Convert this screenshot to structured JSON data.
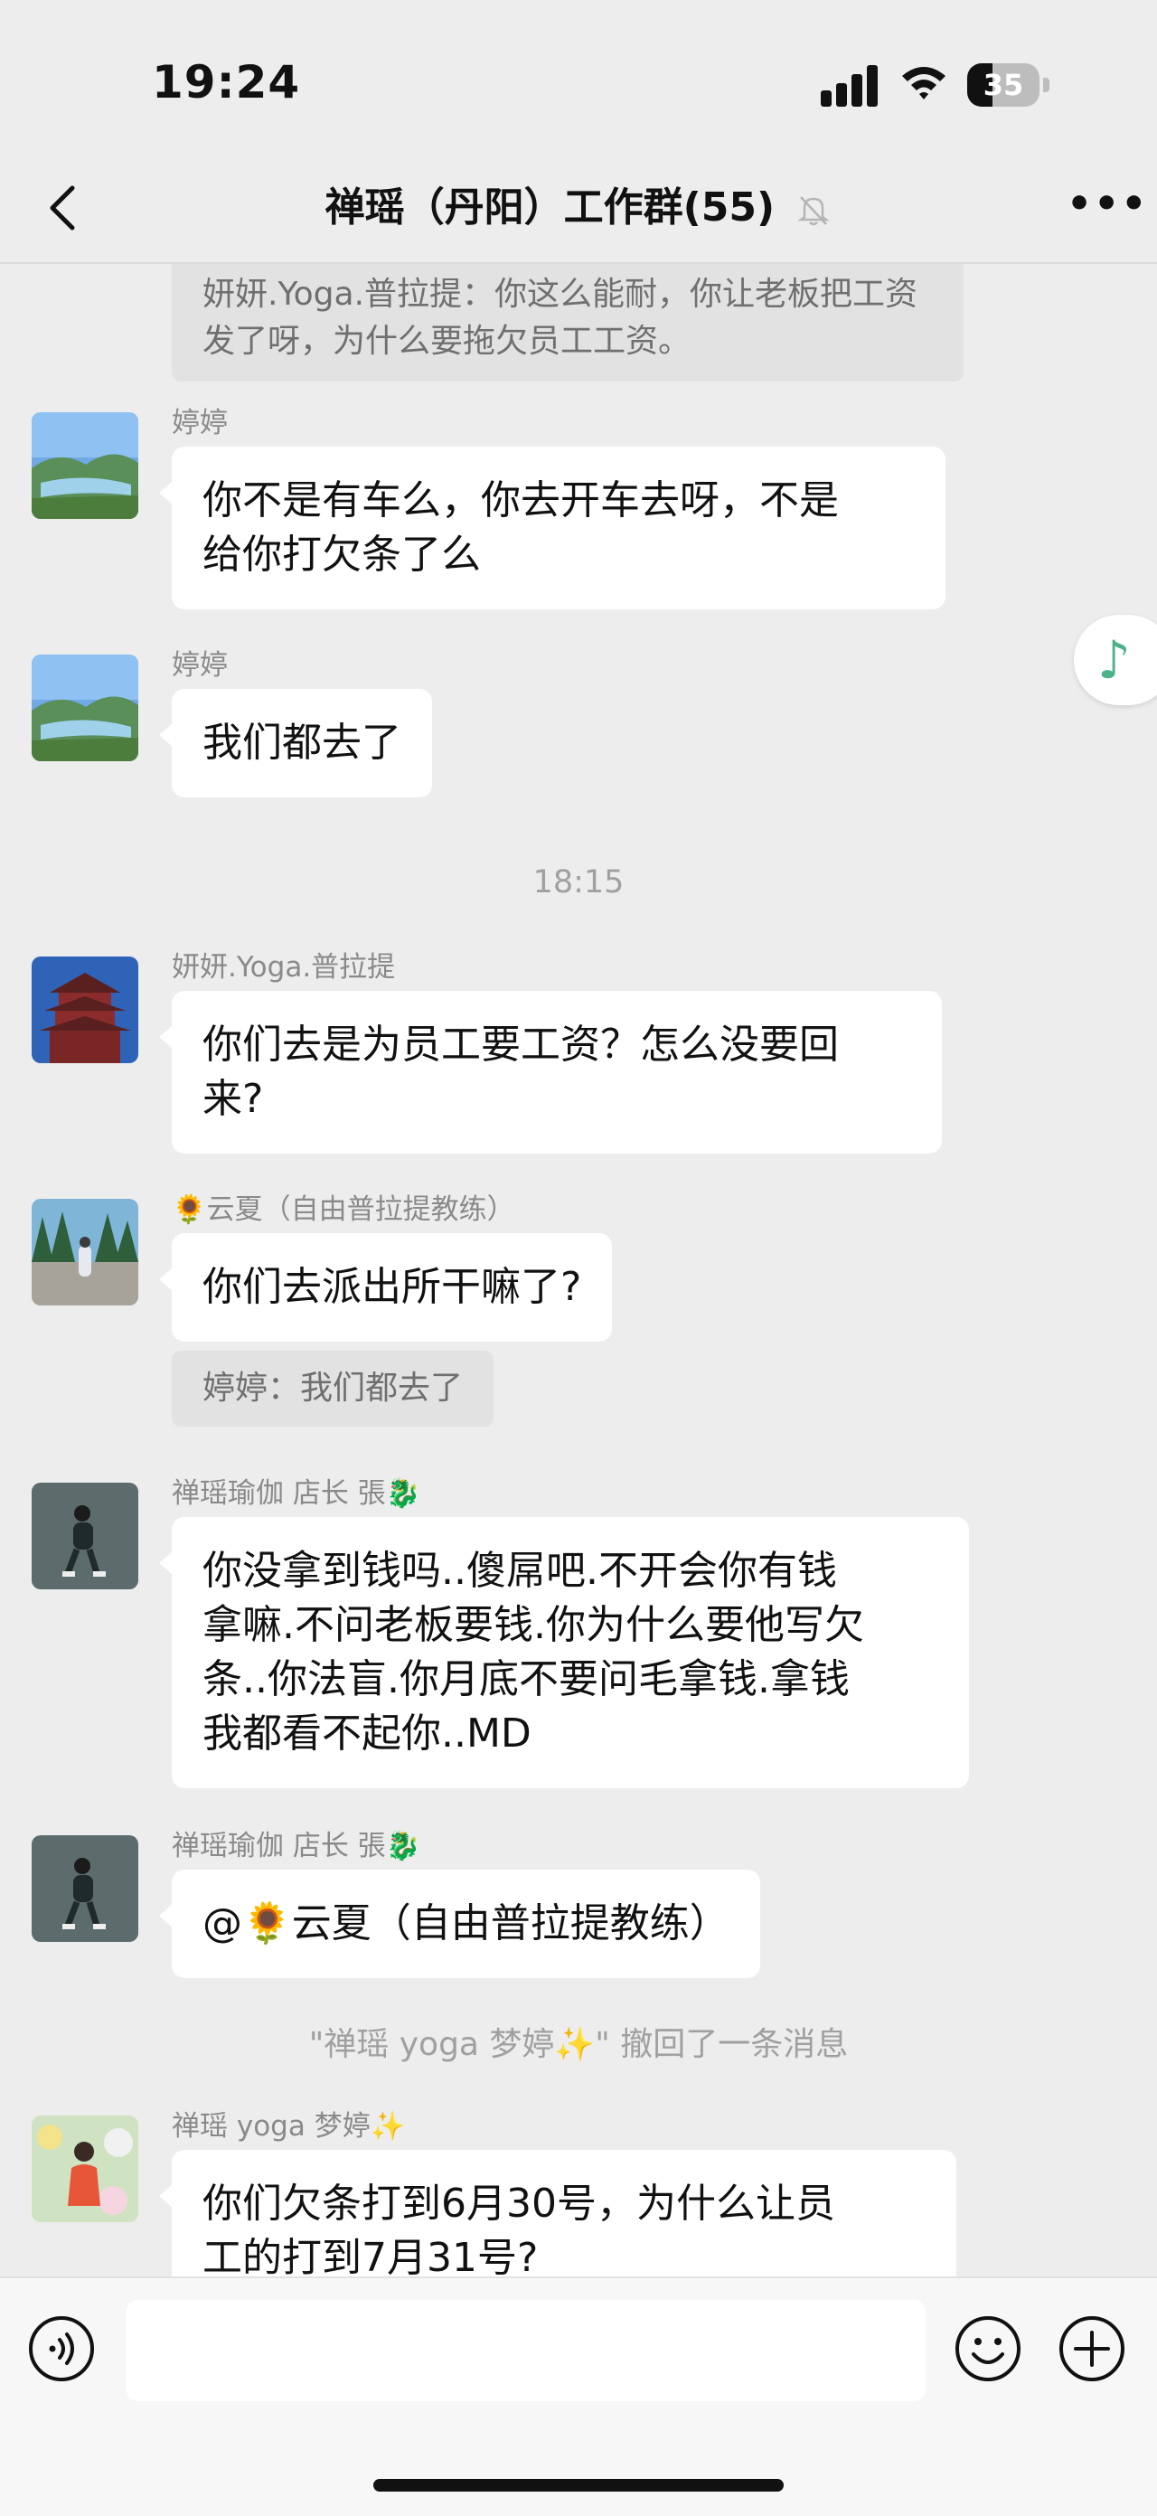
{
  "status": {
    "time": "19:24",
    "battery": "35",
    "battery_level": 0.35
  },
  "header": {
    "title": "禅瑶（丹阳）工作群(55)",
    "muted": true
  },
  "messages": {
    "m0": {
      "quote": "妍妍.Yoga.普拉提：你这么能耐，你让老板把工资发了呀，为什么要拖欠员工工资。"
    },
    "m1": {
      "sender": "婷婷",
      "line1": "你不是有车么，你去开车去呀，不是",
      "line2": "给你打欠条了么"
    },
    "m2": {
      "sender": "婷婷",
      "line1": "我们都去了"
    },
    "time1": "18:15",
    "m3": {
      "sender": "妍妍.Yoga.普拉提",
      "line1": "你们去是为员工要工资？怎么没要回",
      "line2": "来?"
    },
    "m4": {
      "sender": "🌻云夏（自由普拉提教练）",
      "line1": "你们去派出所干嘛了?",
      "quote": "婷婷：我们都去了"
    },
    "m5": {
      "sender": "禅瑶瑜伽  店长 張🐉",
      "line1": "你没拿到钱吗..傻屌吧.不开会你有钱",
      "line2": "拿嘛.不问老板要钱.你为什么要他写欠",
      "line3": "条..你法盲.你月底不要问毛拿钱.拿钱",
      "line4": "我都看不起你..MD"
    },
    "m6": {
      "sender": "禅瑶瑜伽  店长 張🐉",
      "line1": "@🌻云夏（自由普拉提教练）"
    },
    "recall": "\"禅瑶 yoga 梦婷✨\" 撤回了一条消息",
    "m7": {
      "sender": "禅瑶 yoga 梦婷✨",
      "line1": "你们欠条打到6月30号，为什么让员",
      "line2": "工的打到7月31号?"
    }
  },
  "icons": {
    "back": "chevron-left-icon",
    "mute": "bell-off-icon",
    "more": "more-dots-icon",
    "music": "music-note-icon",
    "voice": "voice-icon",
    "emoji": "emoji-icon",
    "plus": "plus-icon"
  },
  "colors": {
    "background": "#ededed",
    "bubble": "#ffffff",
    "quote_bg": "#e2e2e2",
    "accent": "#4db28a"
  }
}
